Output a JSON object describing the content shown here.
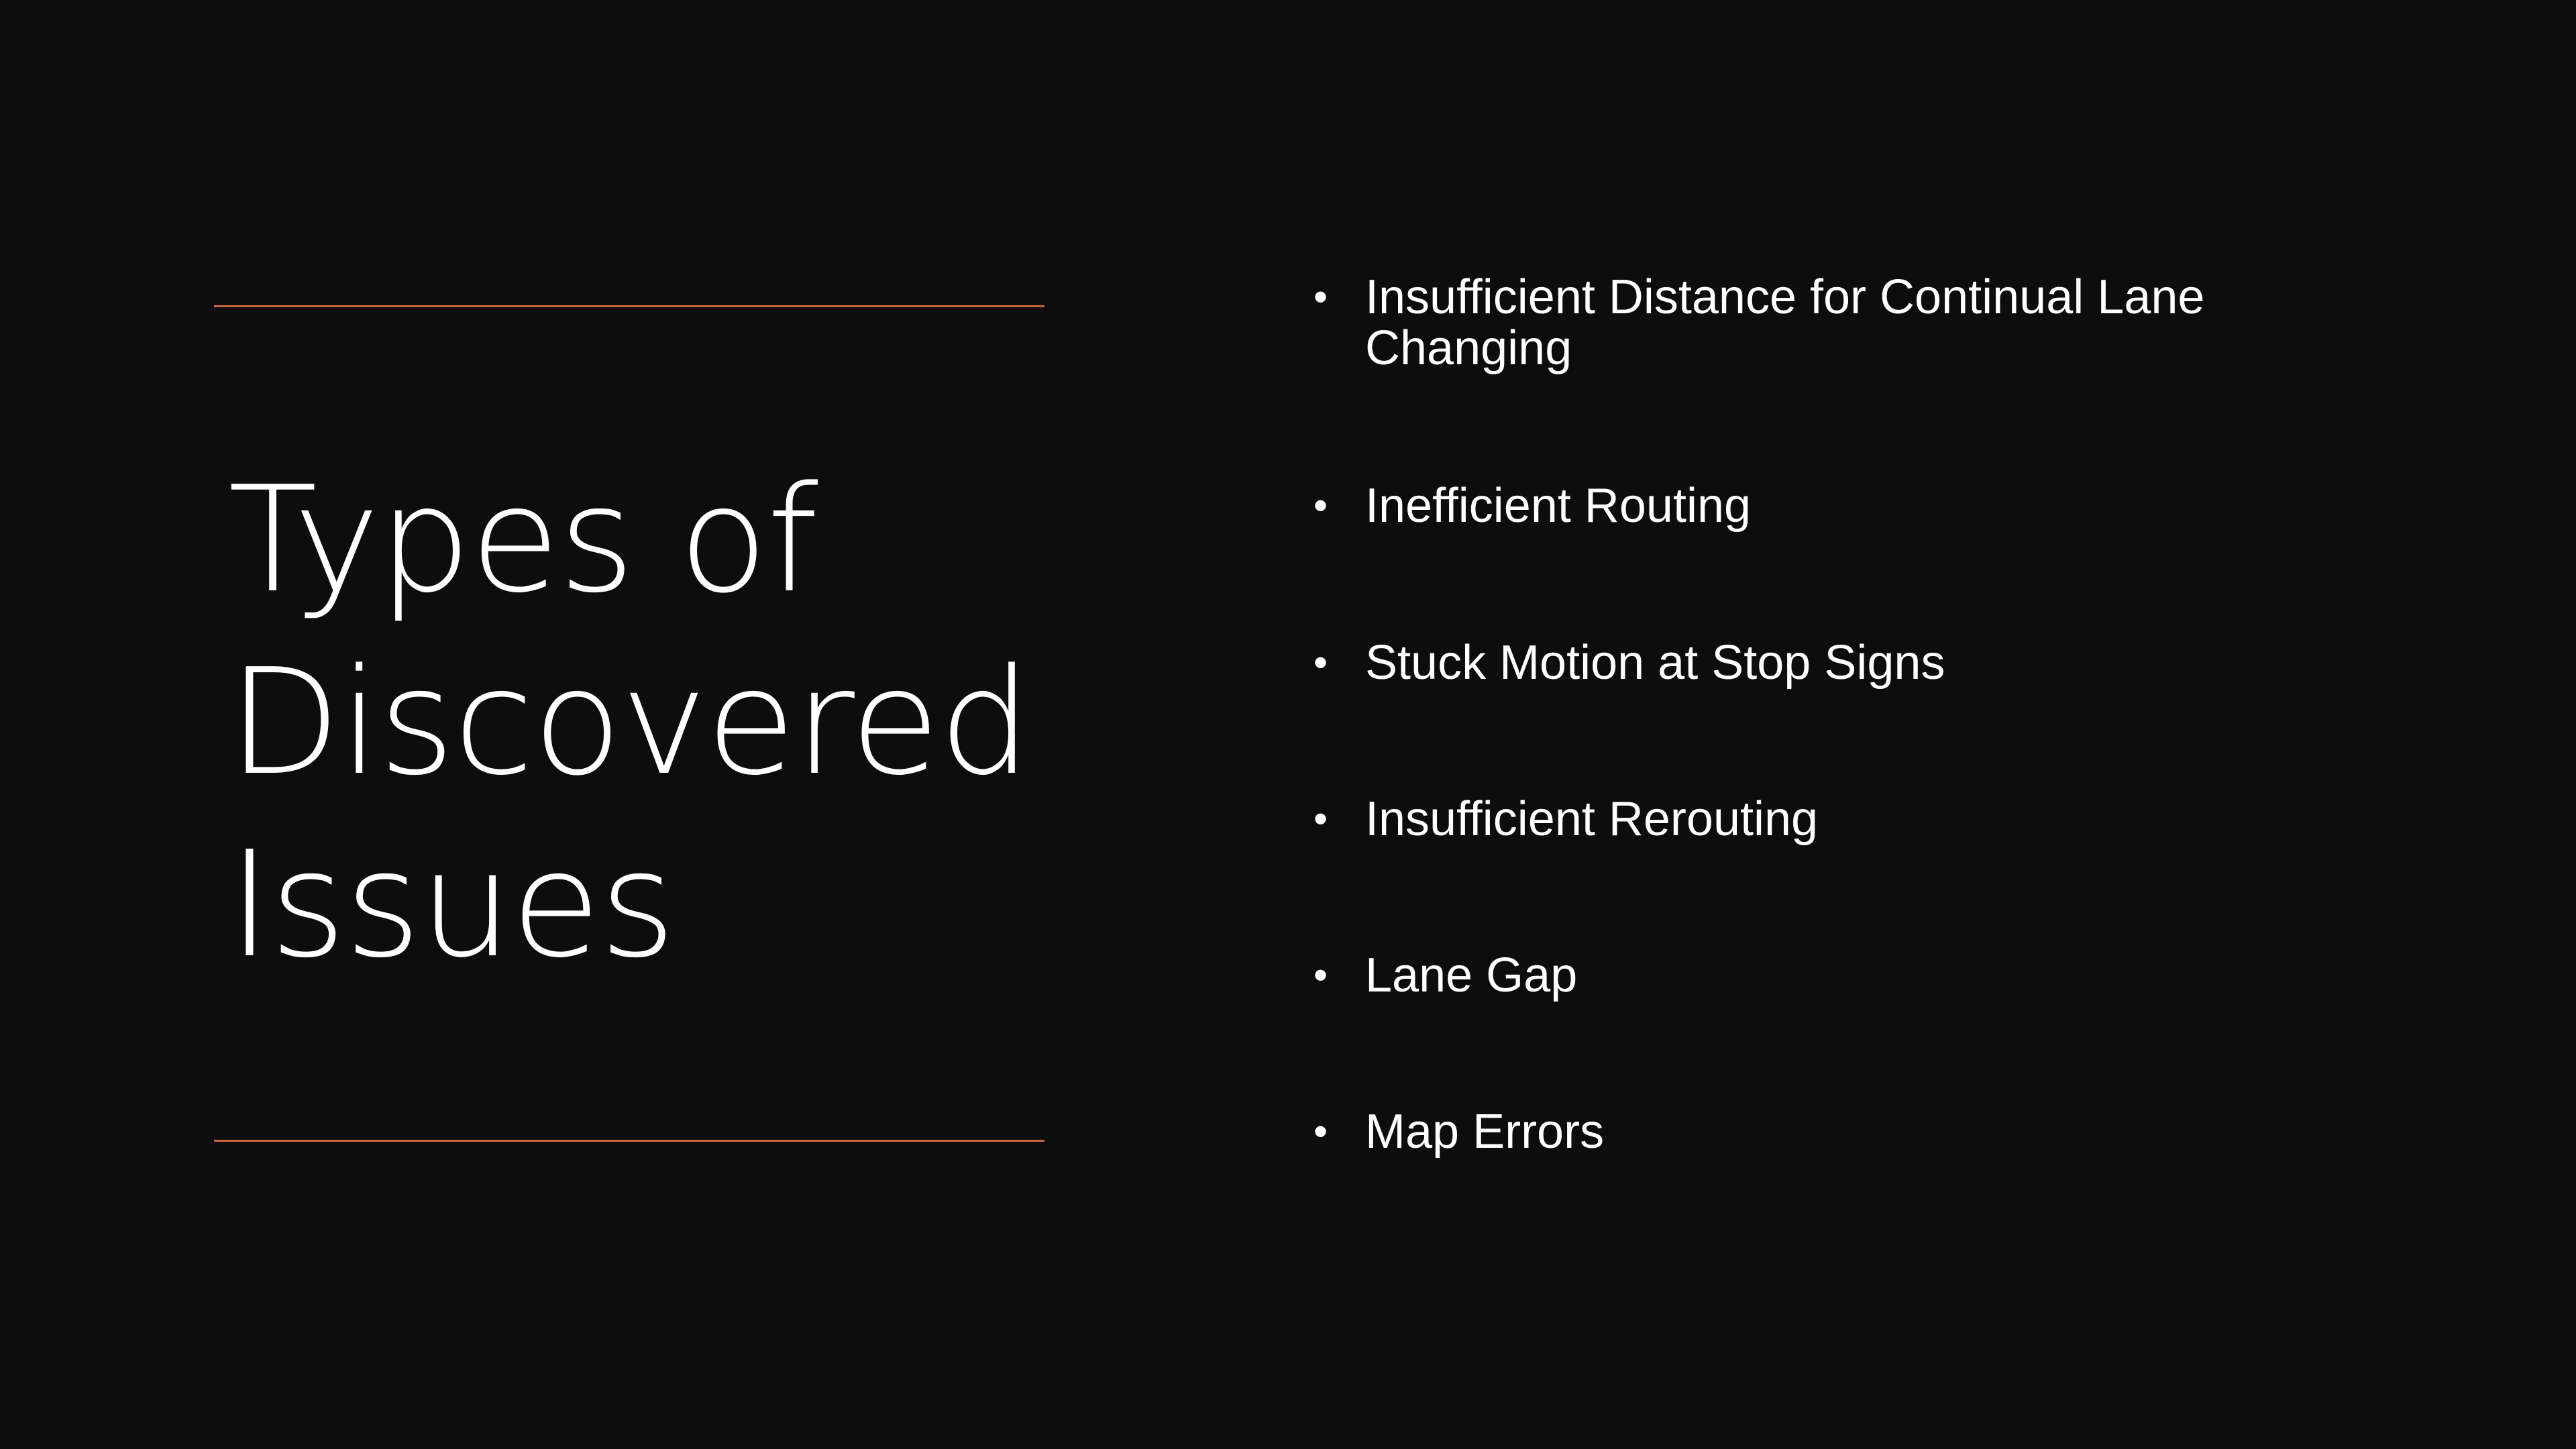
{
  "slide": {
    "title_lines": [
      "Types of",
      "Discovered",
      "Issues"
    ],
    "bullets": [
      "Insufficient Distance for Continual Lane Changing",
      "Inefficient Routing",
      "Stuck Motion at Stop Signs",
      "Insufficient Rerouting",
      "Lane Gap",
      "Map Errors"
    ],
    "bullet_glyph": "•",
    "colors": {
      "background": "#0d0d0d",
      "text": "#ffffff",
      "accent_rule": "#c8663c"
    }
  }
}
